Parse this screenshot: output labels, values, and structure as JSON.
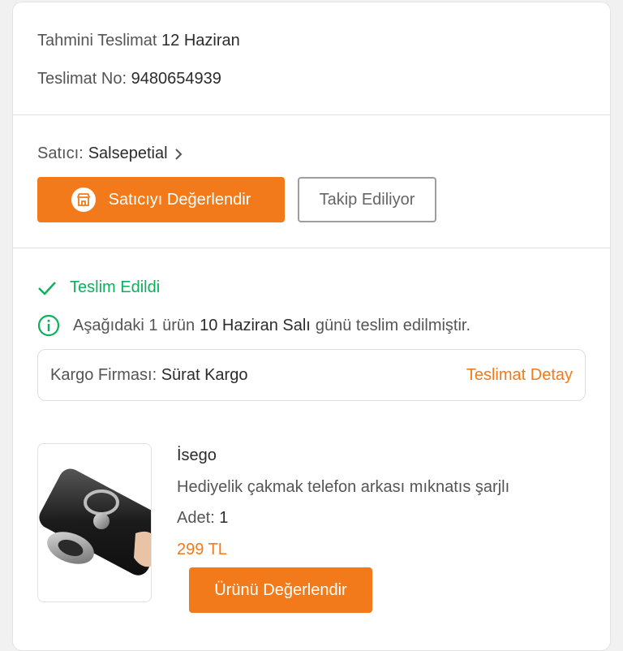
{
  "delivery": {
    "estimated_label": "Tahmini Teslimat",
    "estimated_value": "12 Haziran",
    "number_label": "Teslimat No:",
    "number_value": "9480654939"
  },
  "seller": {
    "label": "Satıcı:",
    "name": "Salsepetial",
    "rate_button": "Satıcıyı Değerlendir",
    "follow_button": "Takip Ediliyor"
  },
  "shipment": {
    "status": "Teslim Edildi",
    "info_prefix": "Aşağıdaki 1 ürün",
    "info_date": "10 Haziran Salı",
    "info_suffix": "günü teslim edilmiştir.",
    "cargo_label": "Kargo Firması:",
    "cargo_value": "Sürat Kargo",
    "detail_link": "Teslimat Detay"
  },
  "product": {
    "brand": "İsego",
    "name": "Hediyelik çakmak telefon arkası mıknatıs şarjlı",
    "qty_label": "Adet:",
    "qty_value": "1",
    "price": "299 TL",
    "rate_button": "Ürünü Değerlendir"
  },
  "colors": {
    "accent": "#f27a1a",
    "success": "#0bb15a",
    "info": "#0bb15a"
  }
}
